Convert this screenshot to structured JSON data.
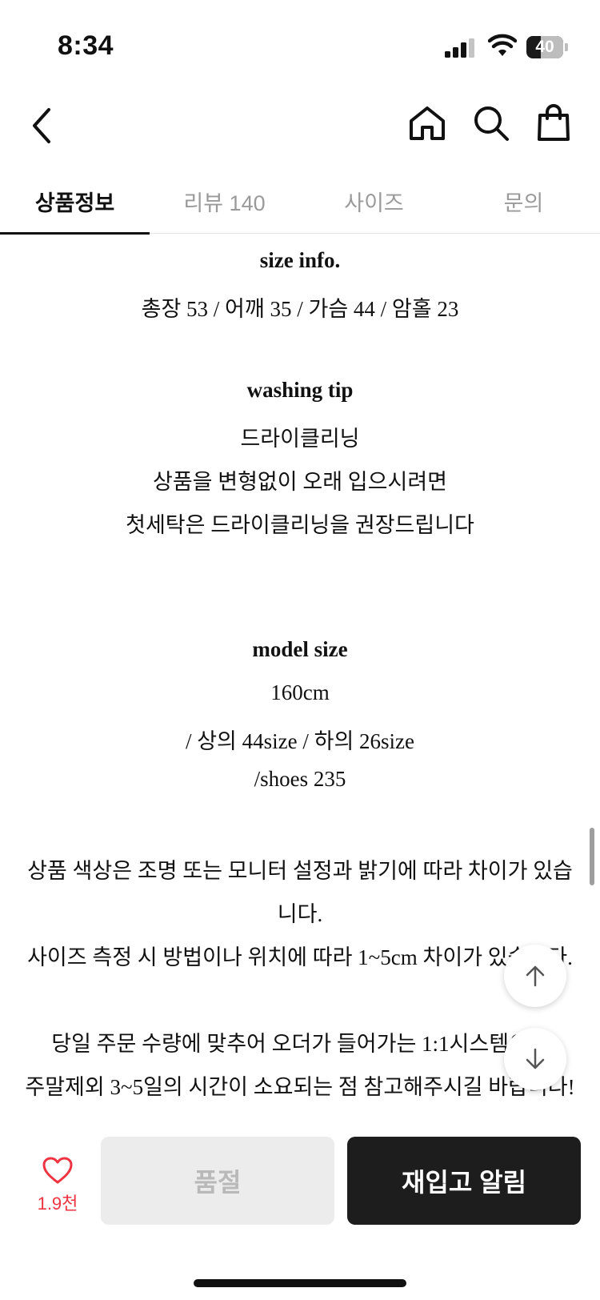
{
  "status_bar": {
    "time": "8:34",
    "battery_level": "40",
    "battery_fraction": 0.4,
    "icons": [
      "signal-icon",
      "wifi-icon",
      "battery-icon"
    ]
  },
  "header": {
    "icons": [
      "back-chevron-icon",
      "home-icon",
      "search-icon",
      "shopping-bag-icon"
    ]
  },
  "tabs": [
    {
      "label": "상품정보",
      "active": true
    },
    {
      "label": "리뷰 140",
      "active": false
    },
    {
      "label": "사이즈",
      "active": false
    },
    {
      "label": "문의",
      "active": false
    }
  ],
  "content": {
    "size_info_title": "size info.",
    "size_info_text": "총장 53 / 어깨 35 / 가슴 44 / 암홀 23",
    "washing_title": "washing tip",
    "washing_lines": [
      "드라이클리닝",
      "상품을 변형없이 오래 입으시려면",
      "첫세탁은 드라이클리닝을 권장드립니다"
    ],
    "model_title": "model size",
    "model_lines": [
      "160cm",
      "/ 상의 44size / 하의 26size",
      "/shoes 235"
    ],
    "notice_lines": [
      "상품 색상은 조명 또는 모니터 설정과 밝기에 따라 차이가 있습",
      "니다.",
      "사이즈 측정 시 방법이나 위치에 따라 1~5cm 차이가 있습니다.",
      "당일 주문 수량에 맞추어 오더가 들어가는 1:1시스템으로",
      "주말제외 3~5일의 시간이 소요되는 점 참고해주시길 바랍니다!"
    ]
  },
  "bottom_bar": {
    "like_count": "1.9천",
    "soldout_label": "품절",
    "restock_label": "재입고 알림"
  },
  "colors": {
    "accent_red": "#ef3340",
    "dark_button": "#1d1d1d",
    "disabled_button": "#ececec"
  }
}
